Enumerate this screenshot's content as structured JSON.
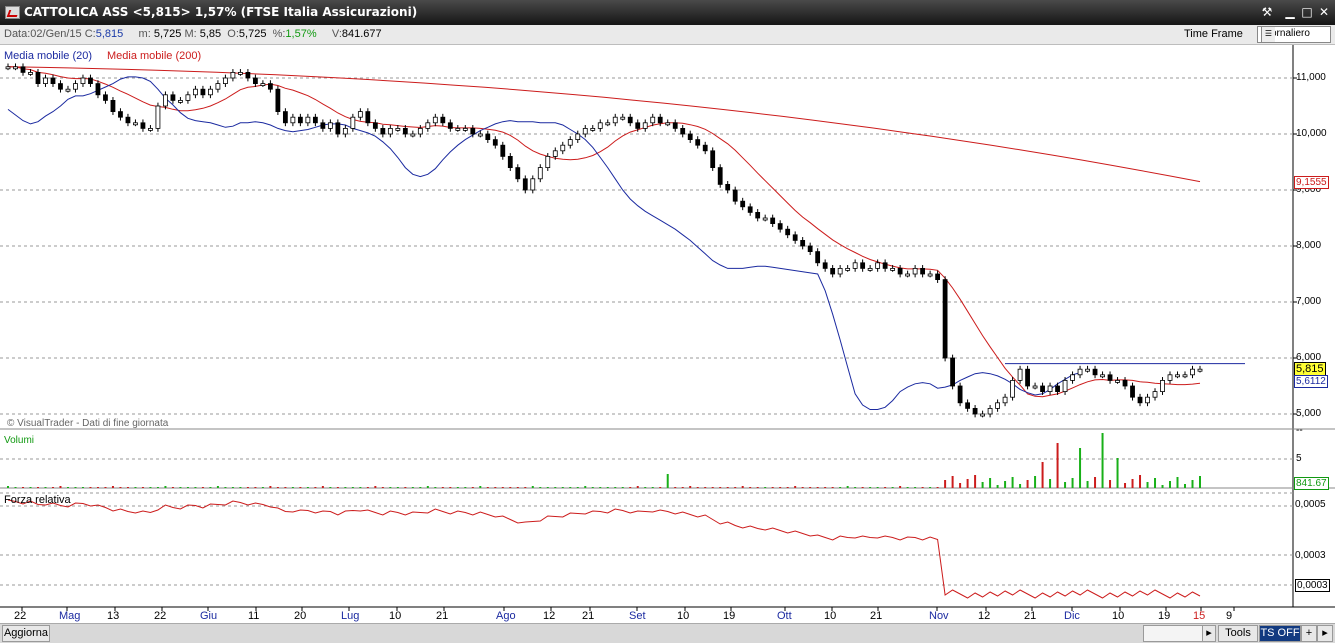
{
  "window": {
    "title": "CATTOLICA ASS <5,815> 1,57%  (FTSE Italia Assicurazioni)"
  },
  "ohlc": {
    "data_label": "Data:",
    "data": "02/Gen/15",
    "c_label": "C:",
    "c": "5,815",
    "m_label": "m:",
    "m": "5,725",
    "mx_label": "M:",
    "mx": "5,85",
    "o_label": "O:",
    "o": "5,725",
    "pct_label": "%:",
    "pct": "1,57%",
    "v_label": "V:",
    "v": "841.677"
  },
  "timeframe": {
    "label": "Time Frame",
    "selected": "Giornaliero"
  },
  "legend": {
    "ma20": "Media mobile (20)",
    "ma200": "Media mobile (200)"
  },
  "watermark": "© VisualTrader - Dati di fine giornata",
  "panes": {
    "volume": "Volumi",
    "rs": "Forza relativa"
  },
  "price_axis": [
    "11,000",
    "10,000",
    "9,000",
    "8,000",
    "7,000",
    "6,000",
    "5,000"
  ],
  "price_tags": {
    "last": "5,815",
    "ma20": "5,6112",
    "ma200": "9,1555"
  },
  "volume_axis": {
    "mid": "5",
    "top": "--",
    "last": "841.67"
  },
  "rs_axis": [
    "0,0005",
    "0,0003",
    "0,0003"
  ],
  "x_labels": [
    "22",
    "Mag",
    "13",
    "22",
    "Giu",
    "11",
    "20",
    "Lug",
    "10",
    "21",
    "Ago",
    "12",
    "21",
    "Set",
    "10",
    "19",
    "Ott",
    "10",
    "21",
    "Nov",
    "12",
    "21",
    "Dic",
    "10",
    "19",
    "15",
    "9"
  ],
  "colors": {
    "ma20": "#1b2aa0",
    "ma200": "#cc1c1c",
    "up": "#18b018",
    "down": "#cc1c1c",
    "last_tag": "#ffff33"
  },
  "statusbar": {
    "refresh": "Aggiorna",
    "tools": "Tools",
    "ts": "TS OFF",
    "plus": "+",
    "right": "▸"
  },
  "chart_data": {
    "type": "candlestick",
    "ylim": [
      4.75,
      11.3
    ],
    "grid": true,
    "series": [
      {
        "name": "CATTOLICA ASS",
        "values": [
          11.2,
          11.2,
          11.1,
          11.1,
          10.9,
          11.0,
          10.9,
          10.8,
          10.8,
          10.9,
          11.0,
          10.9,
          10.7,
          10.6,
          10.4,
          10.3,
          10.2,
          10.2,
          10.1,
          10.1,
          10.5,
          10.7,
          10.6,
          10.6,
          10.7,
          10.8,
          10.7,
          10.8,
          10.9,
          11.0,
          11.1,
          11.1,
          11.0,
          10.9,
          10.9,
          10.8,
          10.4,
          10.2,
          10.3,
          10.2,
          10.3,
          10.2,
          10.1,
          10.2,
          10.0,
          10.1,
          10.3,
          10.4,
          10.2,
          10.1,
          10.0,
          10.1,
          10.1,
          10.0,
          10.0,
          10.1,
          10.2,
          10.3,
          10.2,
          10.1,
          10.1,
          10.1,
          10.0,
          10.0,
          9.9,
          9.8,
          9.6,
          9.4,
          9.2,
          9.0,
          9.2,
          9.4,
          9.6,
          9.7,
          9.8,
          9.9,
          10.0,
          10.1,
          10.1,
          10.2,
          10.2,
          10.3,
          10.3,
          10.2,
          10.1,
          10.2,
          10.3,
          10.2,
          10.2,
          10.1,
          10.0,
          9.9,
          9.8,
          9.7,
          9.4,
          9.1,
          9.0,
          8.8,
          8.7,
          8.6,
          8.5,
          8.5,
          8.4,
          8.3,
          8.2,
          8.1,
          8.0,
          7.9,
          7.7,
          7.6,
          7.5,
          7.6,
          7.6,
          7.7,
          7.6,
          7.6,
          7.7,
          7.6,
          7.6,
          7.5,
          7.5,
          7.6,
          7.5,
          7.5,
          7.4,
          6.0,
          5.5,
          5.2,
          5.1,
          5.0,
          5.0,
          5.1,
          5.2,
          5.3,
          5.6,
          5.8,
          5.5,
          5.5,
          5.4,
          5.5,
          5.4,
          5.6,
          5.7,
          5.8,
          5.8,
          5.7,
          5.7,
          5.6,
          5.6,
          5.5,
          5.3,
          5.2,
          5.3,
          5.4,
          5.6,
          5.7,
          5.7,
          5.7,
          5.8,
          5.8
        ]
      }
    ]
  }
}
